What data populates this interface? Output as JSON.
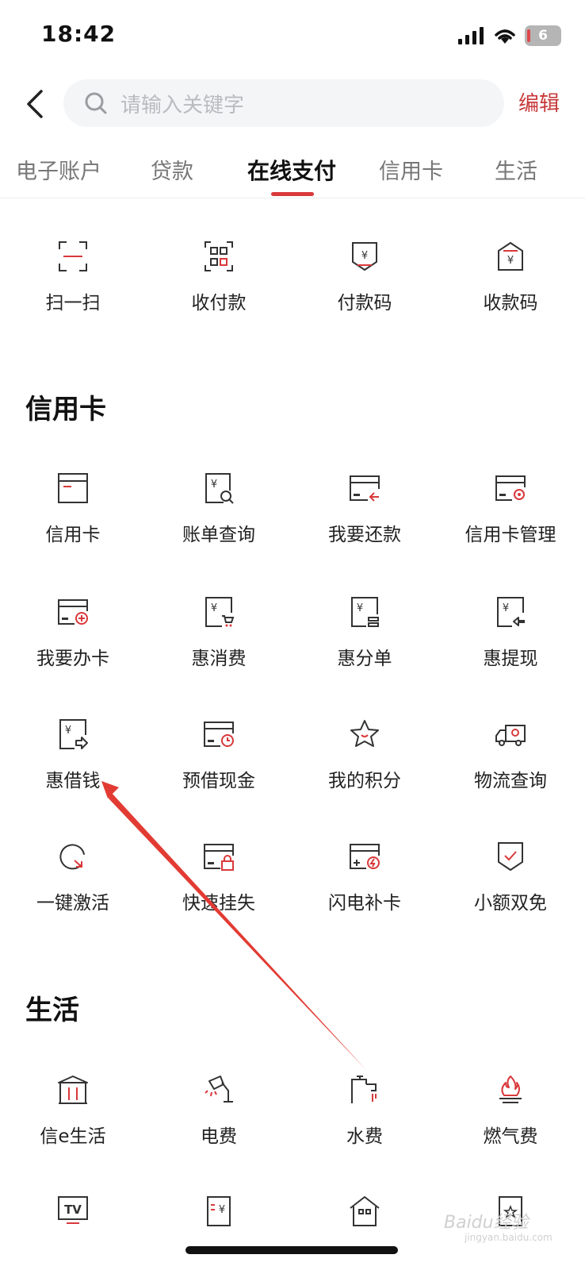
{
  "status_bar": {
    "time": "18:42",
    "battery": "6"
  },
  "header": {
    "search_placeholder": "请输入关键字",
    "edit_label": "编辑"
  },
  "tabs": [
    {
      "label": "电子账户"
    },
    {
      "label": "贷款"
    },
    {
      "label": "在线支付"
    },
    {
      "label": "信用卡"
    },
    {
      "label": "生活"
    }
  ],
  "payment": {
    "items": [
      {
        "label": "扫一扫",
        "icon": "scan-icon"
      },
      {
        "label": "收付款",
        "icon": "qr-code-icon"
      },
      {
        "label": "付款码",
        "icon": "pay-code-icon"
      },
      {
        "label": "收款码",
        "icon": "receive-code-icon"
      }
    ]
  },
  "credit": {
    "title": "信用卡",
    "items": [
      {
        "label": "信用卡",
        "icon": "card-icon"
      },
      {
        "label": "账单查询",
        "icon": "bill-search-icon"
      },
      {
        "label": "我要还款",
        "icon": "repay-icon"
      },
      {
        "label": "信用卡管理",
        "icon": "card-settings-icon"
      },
      {
        "label": "我要办卡",
        "icon": "apply-card-icon"
      },
      {
        "label": "惠消费",
        "icon": "shopping-cart-icon"
      },
      {
        "label": "惠分单",
        "icon": "installment-icon"
      },
      {
        "label": "惠提现",
        "icon": "cash-withdraw-icon"
      },
      {
        "label": "惠借钱",
        "icon": "borrow-icon"
      },
      {
        "label": "预借现金",
        "icon": "cash-advance-icon"
      },
      {
        "label": "我的积分",
        "icon": "star-icon"
      },
      {
        "label": "物流查询",
        "icon": "truck-icon"
      },
      {
        "label": "一键激活",
        "icon": "activate-icon"
      },
      {
        "label": "快速挂失",
        "icon": "lock-card-icon"
      },
      {
        "label": "闪电补卡",
        "icon": "flash-card-icon"
      },
      {
        "label": "小额双免",
        "icon": "shield-check-icon"
      }
    ]
  },
  "life": {
    "title": "生活",
    "items": [
      {
        "label": "信e生活",
        "icon": "bank-icon"
      },
      {
        "label": "电费",
        "icon": "lamp-icon"
      },
      {
        "label": "水费",
        "icon": "faucet-icon"
      },
      {
        "label": "燃气费",
        "icon": "gas-flame-icon"
      },
      {
        "label": "",
        "icon": "tv-icon"
      },
      {
        "label": "",
        "icon": "receipt-icon"
      },
      {
        "label": "",
        "icon": "house-icon"
      },
      {
        "label": "",
        "icon": "star-doc-icon"
      }
    ]
  },
  "watermark": {
    "text": "Baidu经验",
    "sub": "jingyan.baidu.com"
  },
  "colors": {
    "accent": "#c8393b",
    "icon_stroke": "#333333",
    "icon_red": "#d9393b"
  }
}
